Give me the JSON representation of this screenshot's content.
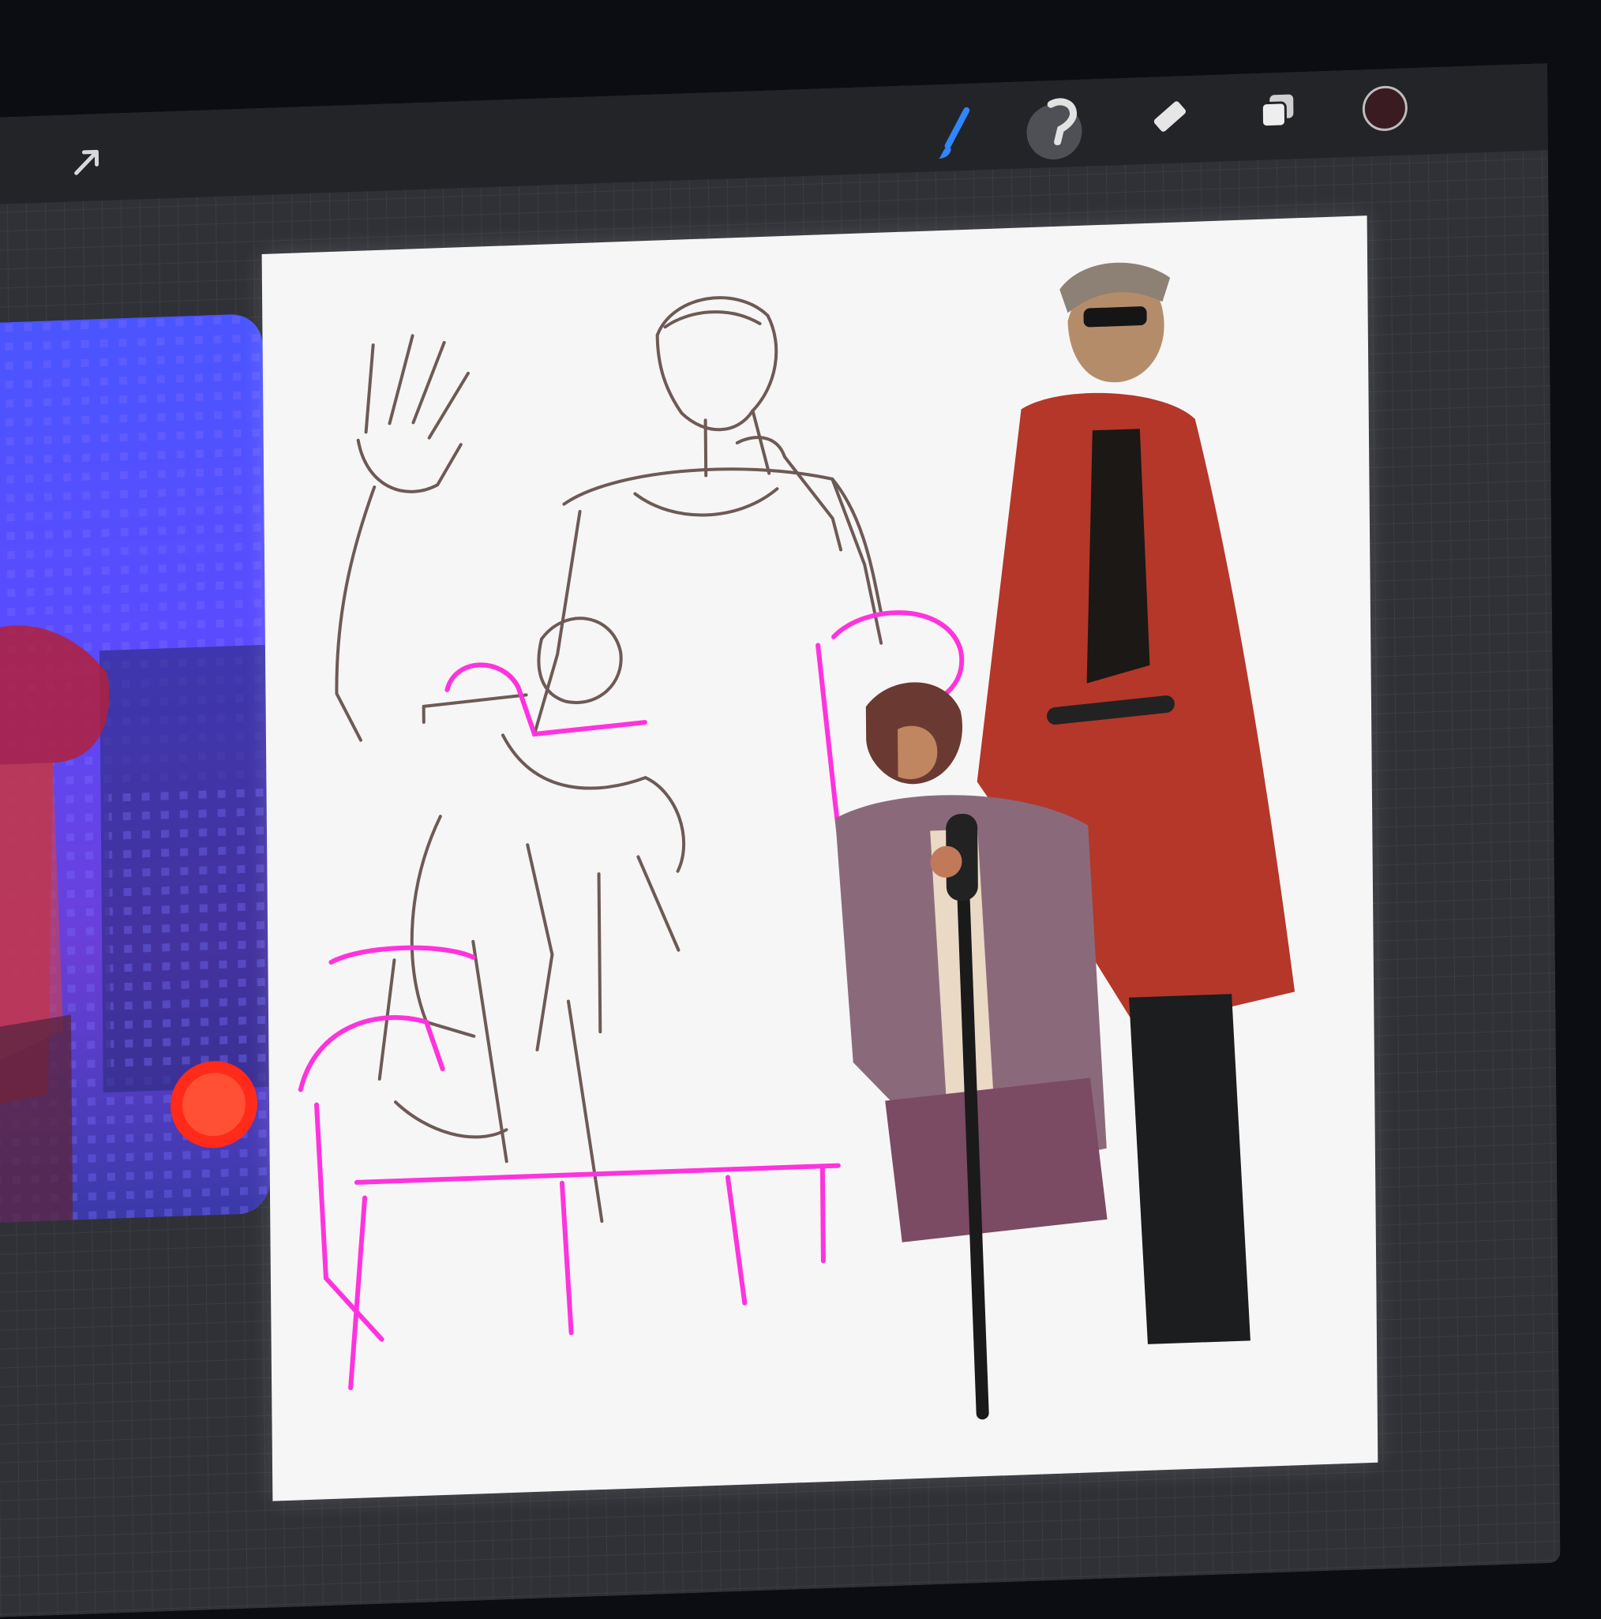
{
  "toolbar": {
    "left_tools": [
      {
        "icon": "modify-arrow-icon"
      }
    ],
    "right_tools": [
      {
        "icon": "brush-icon"
      },
      {
        "icon": "smudge-icon"
      },
      {
        "icon": "eraser-icon"
      },
      {
        "icon": "layers-icon"
      },
      {
        "icon": "color-swatch-icon"
      }
    ],
    "active_tool": "brush-icon",
    "current_color": "#3a1b22",
    "accent_color": "#2f86ff"
  },
  "canvas": {
    "layers": [
      "reference-photo",
      "sketch-lines",
      "guide-lines",
      "painted-figures"
    ],
    "line_color": "#6e5a55",
    "guide_color": "#ff33dd",
    "paint_primary": "#b4372a",
    "paint_secondary": "#8a6a7a"
  },
  "reference_window": {
    "image": "concert-stage-photo"
  }
}
